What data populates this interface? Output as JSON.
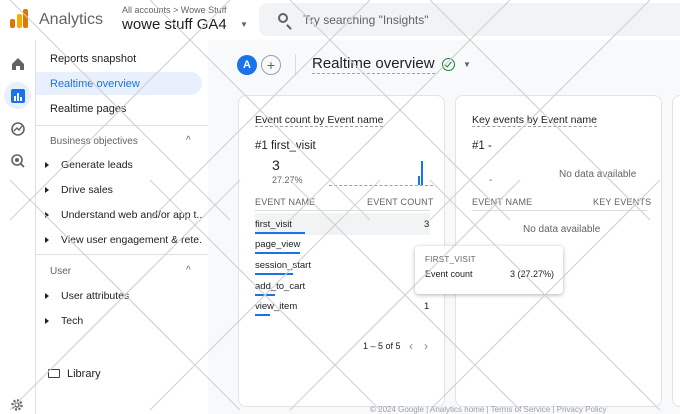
{
  "header": {
    "app_name": "Analytics",
    "breadcrumb": "All accounts > Wowe Stuff",
    "property": "wowe stuff GA4",
    "search_placeholder": "Try searching \"Insights\""
  },
  "nav": {
    "items": [
      "Reports snapshot",
      "Realtime overview",
      "Realtime pages"
    ],
    "section1": "Business objectives",
    "section1_items": [
      "Generate leads",
      "Drive sales",
      "Understand web and/or app t...",
      "View user engagement & rete..."
    ],
    "section2": "User",
    "section2_items": [
      "User attributes",
      "Tech"
    ],
    "library": "Library"
  },
  "main": {
    "avatar": "A",
    "add": "+",
    "title": "Realtime overview"
  },
  "card1": {
    "title": "Event count by Event name",
    "rank": "#1  first_visit",
    "value": "3",
    "percent": "27.27%",
    "col1": "EVENT NAME",
    "col2": "EVENT COUNT",
    "rows": [
      {
        "name": "first_visit",
        "value": "3",
        "share": 1.0
      },
      {
        "name": "page_view",
        "value": "",
        "share": 0.9
      },
      {
        "name": "session_start",
        "value": "",
        "share": 0.75
      },
      {
        "name": "add_to_cart",
        "value": "",
        "share": 0.4
      },
      {
        "name": "view_item",
        "value": "1",
        "share": 0.3
      }
    ],
    "pager": "1 – 5 of 5",
    "prev": "‹",
    "next": "›"
  },
  "card2": {
    "title": "Key events by Event name",
    "rank": "#1  -",
    "value": "-",
    "nodata1": "No data available",
    "col1": "EVENT NAME",
    "col2": "KEY EVENTS",
    "nodata2": "No data available"
  },
  "tooltip": {
    "title": "FIRST_VISIT",
    "label": "Event count",
    "value": "3 (27.27%)"
  },
  "footer": "© 2024 Google | Analytics home | Terms of Service | Privacy Policy",
  "colors": {
    "accent": "#1a73e8",
    "ok": "#188038",
    "logo_orange": "#e37400",
    "logo_yellow": "#f9ab00"
  }
}
